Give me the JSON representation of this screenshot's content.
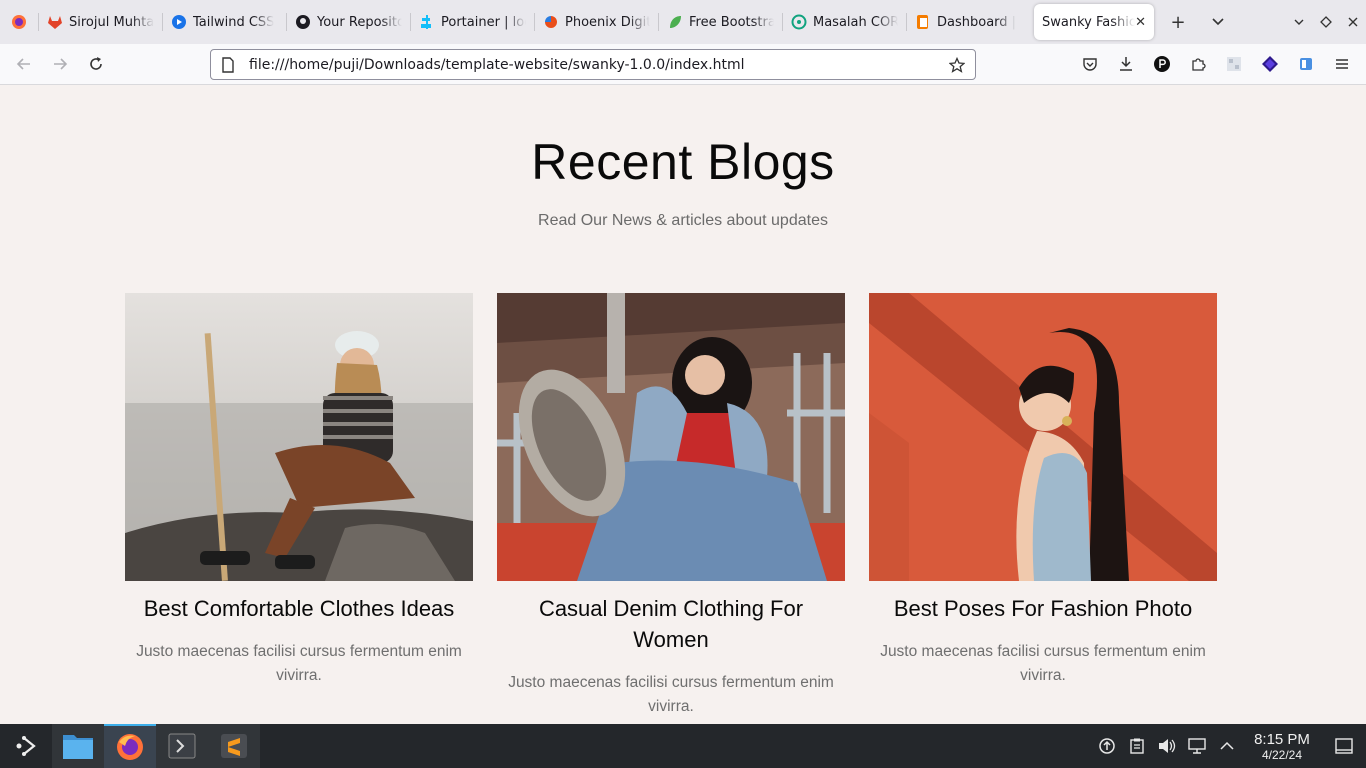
{
  "browser": {
    "tabs": [
      {
        "label": "Sirojul Muhtar",
        "icon": "gitlab-icon",
        "color": "#e24329"
      },
      {
        "label": "Tailwind CSS",
        "icon": "play-circle-icon",
        "color": "#1a73e8"
      },
      {
        "label": "Your Repositories",
        "icon": "github-icon",
        "color": "#1c1b22"
      },
      {
        "label": "Portainer | local",
        "icon": "portainer-icon",
        "color": "#13bef9"
      },
      {
        "label": "Phoenix Digital",
        "icon": "phoenix-icon",
        "color": "#e94e1b"
      },
      {
        "label": "Free Bootstrap",
        "icon": "leaf-icon",
        "color": "#4caf50"
      },
      {
        "label": "Masalah CORS",
        "icon": "openai-icon",
        "color": "#10a37f"
      },
      {
        "label": "Dashboard | ",
        "icon": "dashboard-icon",
        "color": "#f57c00"
      },
      {
        "label": "Swanky Fashion",
        "icon": "",
        "color": "",
        "active": true
      }
    ],
    "url": "file:///home/puji/Downloads/template-website/swanky-1.0.0/index.html"
  },
  "page": {
    "title": "Recent Blogs",
    "subtitle": "Read Our News & articles about updates",
    "cards": [
      {
        "title": "Best Comfortable Clothes Ideas",
        "excerpt": "Justo maecenas facilisi cursus fermentum enim vivirra."
      },
      {
        "title": "Casual Denim Clothing For Women",
        "excerpt": "Justo maecenas facilisi cursus fermentum enim vivirra."
      },
      {
        "title": "Best Poses For Fashion Photo",
        "excerpt": "Justo maecenas facilisi cursus fermentum enim vivirra."
      }
    ]
  },
  "taskbar": {
    "time": "8:15 PM",
    "date": "4/22/24"
  },
  "colors": {
    "page_bg": "#f6f1ef",
    "accent_blue": "#3daee9",
    "taskbar_bg": "#24272b"
  }
}
